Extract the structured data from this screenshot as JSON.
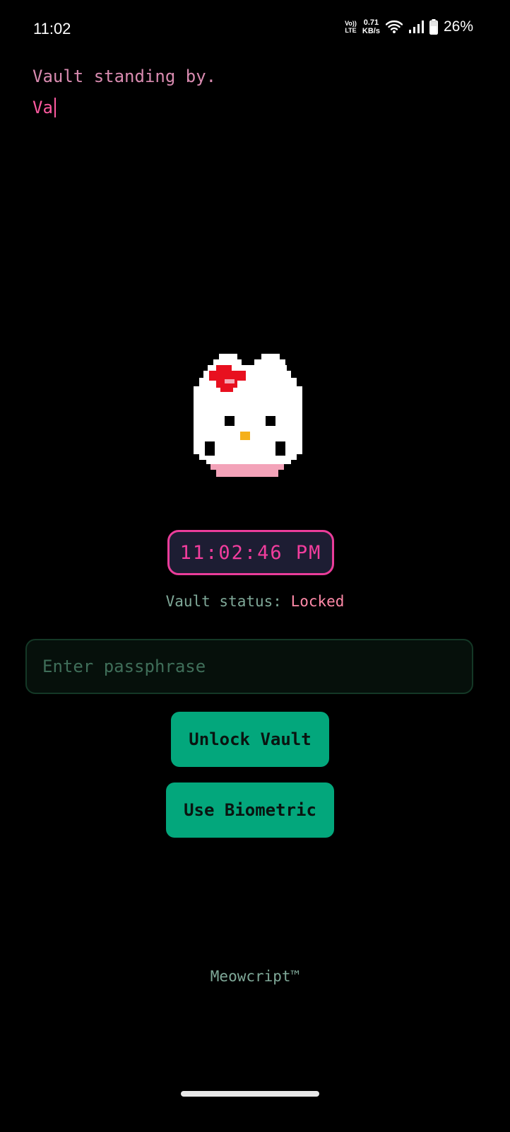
{
  "status_bar": {
    "time": "11:02",
    "volte_top": "Vo))",
    "volte_bottom": "LTE",
    "net_speed_value": "0.71",
    "net_speed_unit": "KB/s",
    "battery_percent": "26%",
    "icons": [
      "volte-icon",
      "wifi-icon",
      "signal-icon",
      "battery-icon"
    ]
  },
  "terminal": {
    "line1": "Vault standing by.",
    "line2": "Va"
  },
  "clock": {
    "time": "11:02:46 PM"
  },
  "vault_status": {
    "label": "Vault status: ",
    "state": "Locked"
  },
  "passphrase": {
    "placeholder": "Enter passphrase",
    "value": ""
  },
  "buttons": {
    "unlock": "Unlock Vault",
    "biometric": "Use Biometric"
  },
  "footer": {
    "brand": "Meowcript™"
  },
  "colors": {
    "background": "#000000",
    "accent_pink": "#f23d9d",
    "accent_green": "#03a77c",
    "status_text": "#7fa898",
    "locked": "#ff8aa8"
  },
  "mascot": {
    "icon": "pixel-cat-icon"
  }
}
